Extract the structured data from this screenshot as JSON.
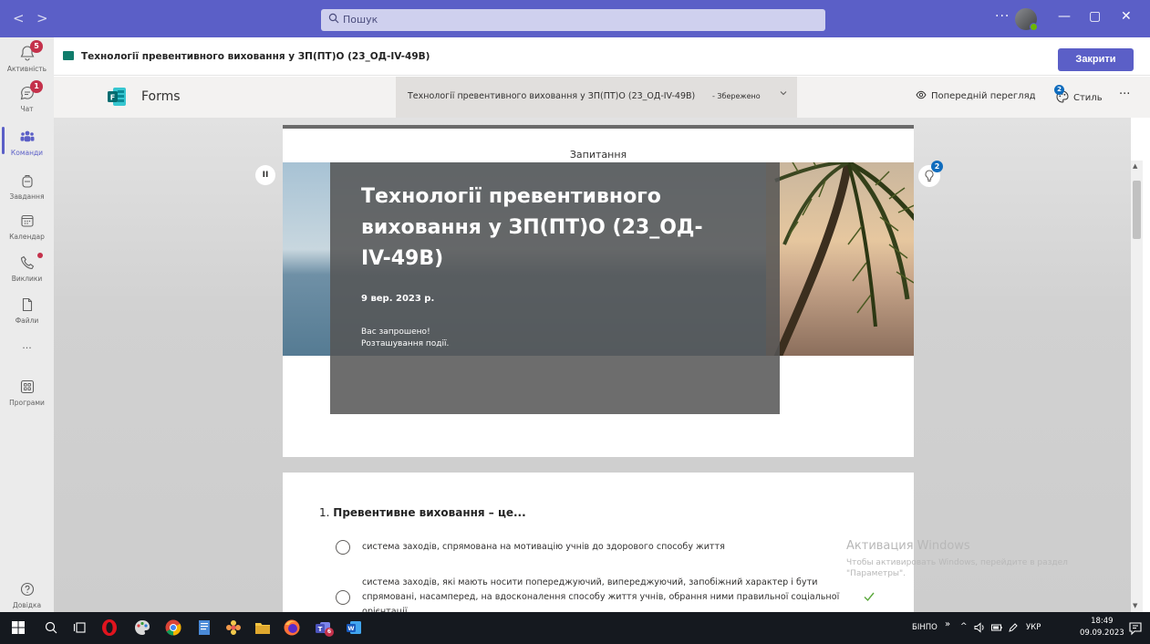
{
  "titlebar": {
    "back": "<",
    "forward": ">",
    "search_placeholder": "Пошук",
    "more": "···",
    "minimize": "—",
    "maximize": "▢",
    "close": "✕"
  },
  "rail": [
    {
      "name": "activity",
      "label": "Активність",
      "badge": "5"
    },
    {
      "name": "chat",
      "label": "Чат",
      "badge": "1"
    },
    {
      "name": "teams",
      "label": "Команди",
      "badge": null
    },
    {
      "name": "assignments",
      "label": "Завдання",
      "badge": null
    },
    {
      "name": "calendar",
      "label": "Календар",
      "badge": null
    },
    {
      "name": "calls",
      "label": "Виклики",
      "badge": null
    },
    {
      "name": "files",
      "label": "Файли",
      "badge": null
    },
    {
      "name": "more",
      "label": "···",
      "badge": null
    },
    {
      "name": "apps",
      "label": "Програми",
      "badge": null
    },
    {
      "name": "help",
      "label": "Довідка",
      "badge": null
    }
  ],
  "apphead": {
    "title": "Технології превентивного виховання у ЗП(ПТ)О (23_ОД-IV-49В)",
    "close_label": "Закрити"
  },
  "formsbar": {
    "app_name": "Forms",
    "form_title": "Технології превентивного виховання у ЗП(ПТ)О (23_ОД-IV-49В)",
    "saved": "- Збережено",
    "preview": "Попередній перегляд",
    "style": "Стиль",
    "style_badge": "2",
    "more": "···"
  },
  "form": {
    "tab": "Запитання",
    "heading": "Технології превентивного виховання у ЗП(ПТ)О (23_ОД-IV-49В)",
    "date": "9 вер. 2023 р.",
    "desc_line1": "Вас запрошено!",
    "desc_line2": "Розташування події.",
    "pause": "II",
    "ideas_badge": "2"
  },
  "question": {
    "number": "1.",
    "text": "Превентивне виховання – це...",
    "options": [
      {
        "line1": "система заходів, спрямована на мотивацію учнів до здорового способу життя",
        "line2": "",
        "line3": "",
        "correct": false
      },
      {
        "line1": "система заходів, які мають носити попереджуючий, випереджуючий, запобіжний характер і бути",
        "line2": "спрямовані, насамперед, на вдосконалення способу життя учнів, обрання ними правильної соціальної",
        "line3": "орієнтації",
        "correct": true
      }
    ]
  },
  "watermark": {
    "line1": "Активация Windows",
    "line2": "Чтобы активировать Windows, перейдите в раздел",
    "line3": "\"Параметры\"."
  },
  "taskbar": {
    "tray_app": "БІНПО",
    "lang": "УКР",
    "time": "18:49",
    "date": "09.09.2023",
    "teams_badge": "6"
  }
}
